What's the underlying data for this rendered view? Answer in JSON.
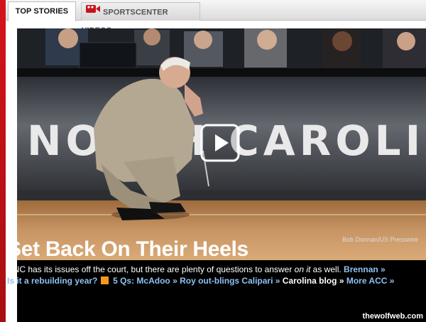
{
  "tabs": [
    {
      "label": "TOP STORIES",
      "active": true
    },
    {
      "label": "SPORTSCENTER VIDEOS",
      "active": false
    }
  ],
  "photo": {
    "credit": "Bob Donnan/US Presswire",
    "banner_text": "NORTH CAROLINA"
  },
  "story": {
    "headline": "Set Back On Their Heels",
    "summary_before": "UNC has its issues off the court, but there are plenty of questions to answer ",
    "summary_em": "on it",
    "summary_after": " as well.",
    "author_link": "Brennan »"
  },
  "links": [
    {
      "label": "Is it a rebuilding year?",
      "style": "link"
    },
    {
      "label": "5 Qs: McAdoo »",
      "style": "link",
      "icon": "rss-icon"
    },
    {
      "label": "Roy out-blings Calipari »",
      "style": "link"
    },
    {
      "label": "Carolina blog",
      "style": "plain"
    },
    {
      "label": "More ACC »",
      "style": "link"
    }
  ],
  "watermark": "thewolfweb.com",
  "icons": {
    "tab_video": "video-camera-icon",
    "play": "play-icon"
  },
  "colors": {
    "accent": "#d3141a",
    "link": "#8fc1f2",
    "caption_bg": "#000000"
  }
}
